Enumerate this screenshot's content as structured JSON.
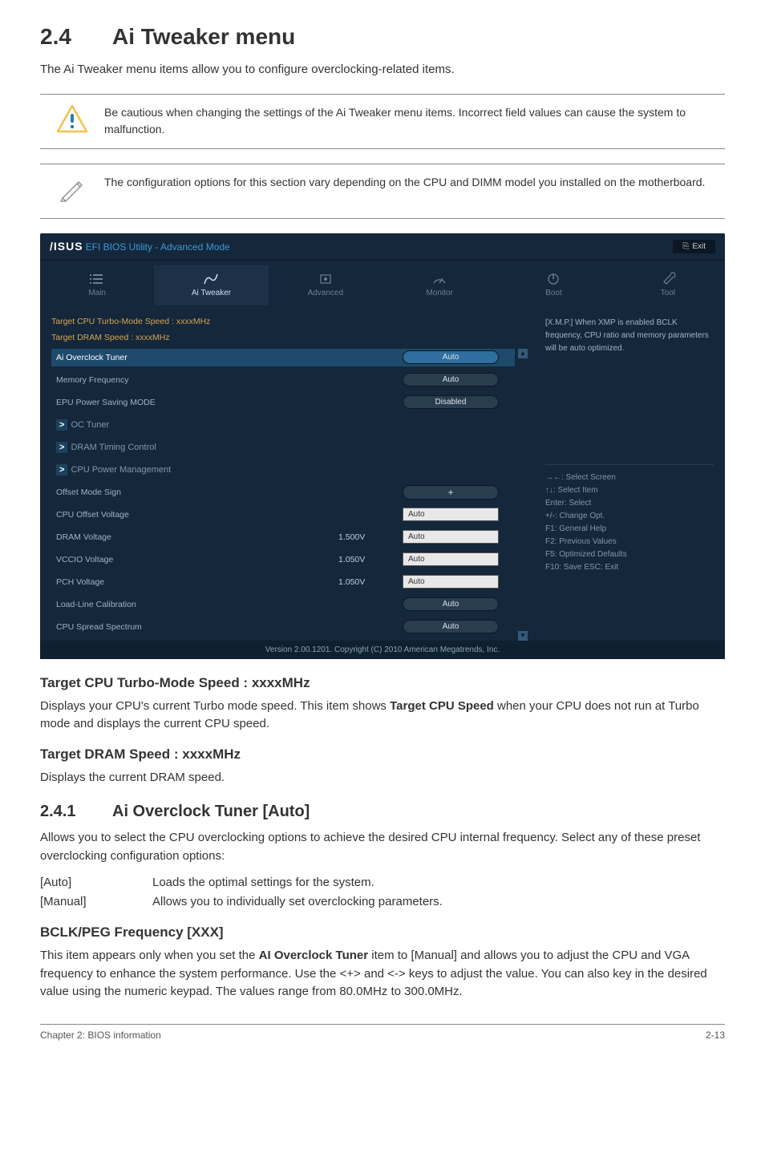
{
  "section": {
    "num": "2.4",
    "title": "Ai Tweaker menu"
  },
  "intro": "The Ai Tweaker menu items allow you to configure overclocking-related items.",
  "callout_warn": "Be cautious when changing the settings of the Ai Tweaker menu items. Incorrect field values can cause the system to malfunction.",
  "callout_note": "The configuration options for this section vary depending on the CPU and DIMM model you installed on the motherboard.",
  "bios": {
    "brand_logo": "/ISUS",
    "title_suffix": "EFI BIOS Utility - Advanced Mode",
    "exit": "Exit",
    "tabs": [
      {
        "label": "Main"
      },
      {
        "label": "Ai  Tweaker"
      },
      {
        "label": "Advanced"
      },
      {
        "label": "Monitor"
      },
      {
        "label": "Boot"
      },
      {
        "label": "Tool"
      }
    ],
    "static1": "Target CPU Turbo-Mode Speed : xxxxMHz",
    "static2": "Target DRAM Speed : xxxxMHz",
    "rows": {
      "ai_overclock": {
        "label": "Ai Overclock Tuner",
        "value": "Auto"
      },
      "mem_freq": {
        "label": "Memory Frequency",
        "value": "Auto"
      },
      "epu": {
        "label": "EPU Power Saving MODE",
        "value": "Disabled"
      },
      "oc_tuner": {
        "label": "OC Tuner"
      },
      "dram_timing": {
        "label": "DRAM Timing Control"
      },
      "cpu_pm": {
        "label": "CPU Power Management"
      },
      "offset_sign": {
        "label": "Offset Mode Sign",
        "value": "+"
      },
      "cpu_offset": {
        "label": "CPU Offset Voltage",
        "value": "Auto"
      },
      "dram_v": {
        "label": "DRAM Voltage",
        "mid": "1.500V",
        "value": "Auto"
      },
      "vccio": {
        "label": "VCCIO Voltage",
        "mid": "1.050V",
        "value": "Auto"
      },
      "pch": {
        "label": "PCH Voltage",
        "mid": "1.050V",
        "value": "Auto"
      },
      "llc": {
        "label": "Load-Line Calibration",
        "value": "Auto"
      },
      "spread": {
        "label": "CPU Spread Spectrum",
        "value": "Auto"
      }
    },
    "help_text": "[X.M.P.] When XMP is enabled BCLK frequency, CPU ratio and memory parameters will be auto optimized.",
    "legend": {
      "l1": "→←:  Select Screen",
      "l2": "↑↓:  Select Item",
      "l3": "Enter:  Select",
      "l4": "+/-:  Change Opt.",
      "l5": "F1:  General Help",
      "l6": "F2:  Previous Values",
      "l7": "F5:  Optimized Defaults",
      "l8": "F10:  Save   ESC:  Exit"
    },
    "footer": "Version  2.00.1201.   Copyright  (C)  2010  American  Megatrends,  Inc."
  },
  "sub1": {
    "heading": "Target CPU Turbo-Mode Speed : xxxxMHz",
    "p": "Displays your CPU's current Turbo mode speed. This item shows Target CPU Speed when your CPU does not run at Turbo mode and displays the current CPU speed.",
    "p_prefix": "Displays your CPU's current Turbo mode speed. This item shows ",
    "p_bold": "Target CPU Speed",
    "p_suffix": " when your CPU does not run at Turbo mode and displays the current CPU speed."
  },
  "sub2": {
    "heading": "Target DRAM Speed : xxxxMHz",
    "p": "Displays the current DRAM speed."
  },
  "sub3": {
    "num": "2.4.1",
    "title": "Ai Overclock Tuner [Auto]",
    "p": "Allows you to select the CPU overclocking options to achieve the desired CPU internal frequency. Select any of these preset overclocking configuration options:",
    "opts": [
      {
        "key": "[Auto]",
        "val": "Loads the optimal settings for the system."
      },
      {
        "key": "[Manual]",
        "val": "Allows you to individually set overclocking parameters."
      }
    ]
  },
  "sub4": {
    "heading": "BCLK/PEG Frequency [XXX]",
    "p_prefix": "This item appears only when you set the ",
    "p_bold": "AI Overclock Tuner",
    "p_suffix": " item to [Manual] and allows you to adjust the CPU and VGA frequency to enhance the system performance. Use the <+> and <-> keys to adjust the value. You can also key in the desired value using the numeric keypad. The values range from 80.0MHz to 300.0MHz."
  },
  "footer": {
    "left": "Chapter 2: BIOS information",
    "right": "2-13"
  }
}
